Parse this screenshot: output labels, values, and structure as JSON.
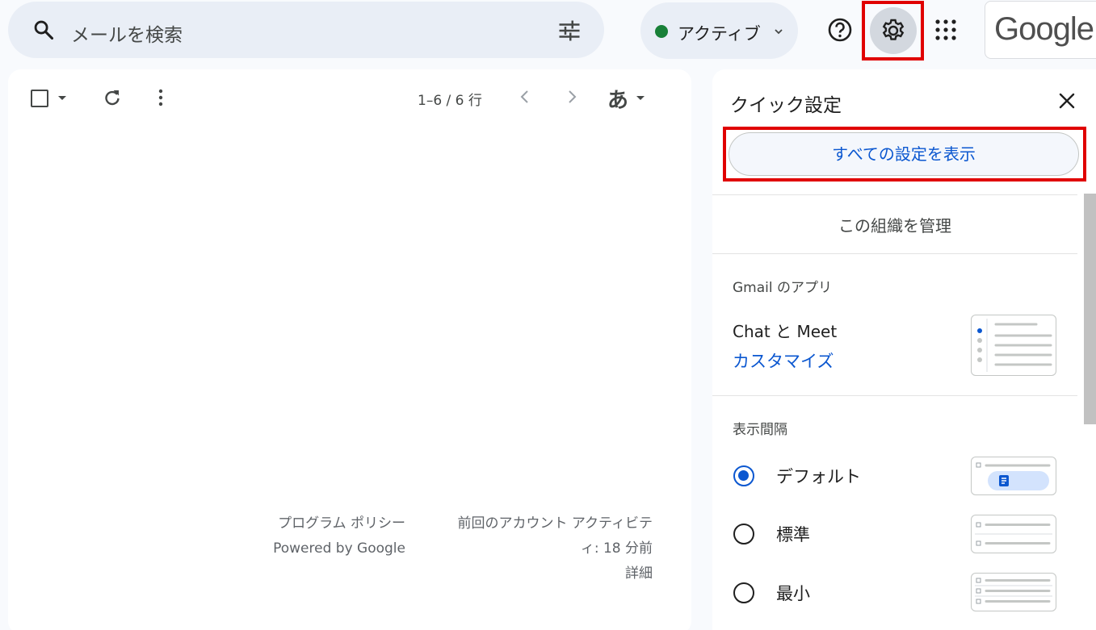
{
  "search": {
    "placeholder": "メールを検索"
  },
  "status": {
    "label": "アクティブ",
    "color": "#188038"
  },
  "account": {
    "logo_text": "Google"
  },
  "toolbar": {
    "count": "1–6 / 6 行",
    "ime": "あ"
  },
  "footer": {
    "policy": "プログラム ポリシー",
    "powered": "Powered by Google",
    "activity_line1": "前回のアカウント アクティビテ",
    "activity_line2": "ィ: 18 分前",
    "details": "詳細"
  },
  "quick_settings": {
    "title": "クイック設定",
    "see_all": "すべての設定を表示",
    "manage_org": "この組織を管理",
    "apps_heading": "Gmail のアプリ",
    "chat_meet": "Chat と Meet",
    "customize": "カスタマイズ",
    "density_heading": "表示間隔",
    "density_options": [
      {
        "label": "デフォルト",
        "selected": true
      },
      {
        "label": "標準",
        "selected": false
      },
      {
        "label": "最小",
        "selected": false
      }
    ]
  },
  "colors": {
    "accent": "#0b57d0",
    "highlight": "#e00000"
  }
}
